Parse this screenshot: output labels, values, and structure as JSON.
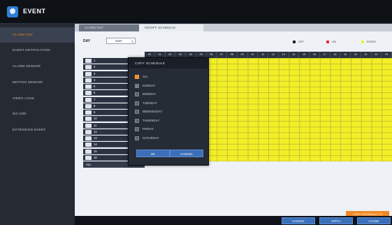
{
  "window": {
    "title": "EVENT",
    "icon": "event-icon"
  },
  "sidebar": {
    "items": [
      {
        "label": "ALARM OUT",
        "active": true
      },
      {
        "label": "EVENT NOTIFICATION",
        "active": false
      },
      {
        "label": "ALARM SENSOR",
        "active": false
      },
      {
        "label": "MOTION SENSOR",
        "active": false
      },
      {
        "label": "VIDEO LOSS",
        "active": false
      },
      {
        "label": "NO HDD",
        "active": false
      },
      {
        "label": "EXTENSION EVENT",
        "active": false
      }
    ]
  },
  "tabs": [
    {
      "label": "ALARM OUT",
      "active": false
    },
    {
      "label": "ON/OFF SCHEDULE",
      "active": true
    }
  ],
  "schedule": {
    "day_label": "DAY",
    "day_value": "SUN",
    "legend": [
      {
        "label": "OFF",
        "color": "#1a1a1a"
      },
      {
        "label": "ON",
        "color": "#e8262a"
      },
      {
        "label": "EVENT",
        "color": "#f3ef26"
      }
    ],
    "hours": [
      "00",
      "01",
      "02",
      "03",
      "04",
      "05",
      "06",
      "07",
      "08",
      "09",
      "10",
      "11",
      "12",
      "13",
      "14",
      "15",
      "16",
      "17",
      "18",
      "19",
      "20",
      "21",
      "22",
      "23"
    ],
    "channels": [
      "1",
      "2",
      "3",
      "4",
      "5",
      "6",
      "7",
      "8",
      "9",
      "10",
      "11",
      "12",
      "13",
      "14",
      "15",
      "16"
    ],
    "all_label": "ALL",
    "cell_color": "#f3ef26"
  },
  "copy_dialog": {
    "title": "COPY SCHEDULE",
    "options": [
      {
        "label": "ALL",
        "state": "orange"
      },
      {
        "label": "SUNDAY",
        "state": "checked"
      },
      {
        "label": "MONDAY",
        "state": "unchecked"
      },
      {
        "label": "TUESDAY",
        "state": "unchecked"
      },
      {
        "label": "WEDNESDAY",
        "state": "unchecked"
      },
      {
        "label": "THURSDAY",
        "state": "unchecked"
      },
      {
        "label": "FRIDAY",
        "state": "unchecked"
      },
      {
        "label": "SATURDAY",
        "state": "unchecked"
      }
    ],
    "ok_label": "OK",
    "cancel_label": "CANCEL"
  },
  "copy_schedule_button": "COPY SCHEDULE TO",
  "footer": {
    "cancel": "CANCEL",
    "apply": "APPLY",
    "close": "CLOSE"
  },
  "colors": {
    "accent": "#f28a1c",
    "button": "#3a6fb9"
  }
}
